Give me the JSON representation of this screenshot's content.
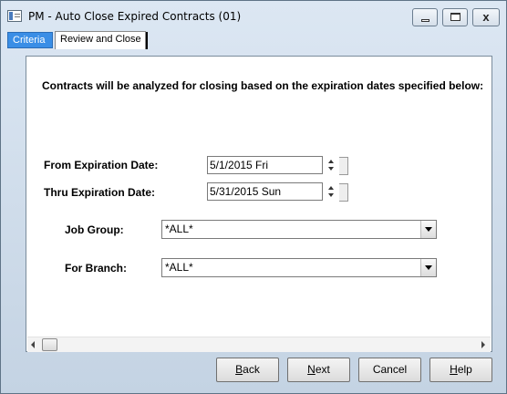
{
  "window": {
    "title": "PM - Auto Close Expired Contracts (01)",
    "close_glyph": "x"
  },
  "tabs": [
    {
      "label": "Criteria",
      "active": true
    },
    {
      "label": "Review and Close",
      "active": false
    }
  ],
  "criteria": {
    "heading": "Contracts will be analyzed for closing based on the expiration dates specified below:",
    "from_date": {
      "label": "From Expiration Date:",
      "value": "5/1/2015 Fri"
    },
    "thru_date": {
      "label": "Thru Expiration Date:",
      "value": "5/31/2015 Sun"
    },
    "job_group": {
      "label": "Job Group:",
      "value": "*ALL*"
    },
    "branch": {
      "label": "For Branch:",
      "value": "*ALL*"
    }
  },
  "buttons": {
    "back": {
      "mnemonic": "B",
      "rest": "ack"
    },
    "next": {
      "mnemonic": "N",
      "rest": "ext"
    },
    "cancel": "Cancel",
    "help": {
      "mnemonic": "H",
      "rest": "elp"
    }
  },
  "icons": [
    "app-icon",
    "minimize-icon",
    "maximize-icon",
    "close-icon",
    "spin-up-icon",
    "spin-down-icon",
    "dropdown-arrow-icon",
    "scroll-left-icon",
    "scroll-right-icon"
  ],
  "colors": {
    "active_tab": "#3a8ee6",
    "title_gradient_top": "#dce7f3"
  }
}
